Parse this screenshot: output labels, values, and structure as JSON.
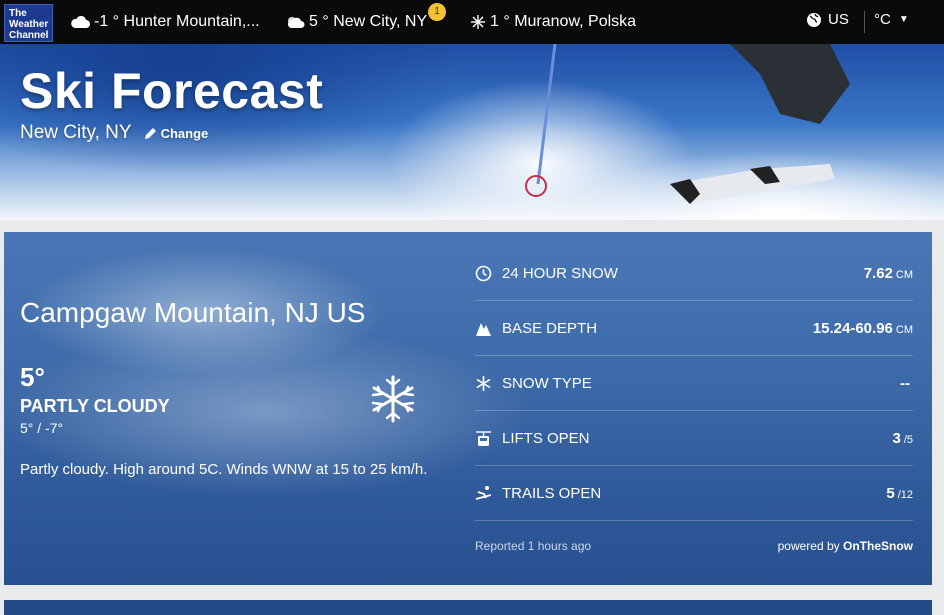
{
  "logo": {
    "line1": "The",
    "line2": "Weather",
    "line3": "Channel"
  },
  "nav": {
    "locations": [
      {
        "temp": "-1 °",
        "name": "Hunter Mountain,...",
        "icon": "cloud-icon"
      },
      {
        "temp": "5 °",
        "name": "New City, NY",
        "icon": "partly-cloudy-icon"
      },
      {
        "temp": "1 °",
        "name": "Muranow, Polska",
        "icon": "snow-icon"
      }
    ],
    "badge_count": "1",
    "region": "US",
    "temp_unit": "°C"
  },
  "hero": {
    "title": "Ski Forecast",
    "city": "New City, NY",
    "change_label": "Change"
  },
  "resort": {
    "name": "Campgaw Mountain, NJ US",
    "current_temp": "5°",
    "condition": "PARTLY CLOUDY",
    "hi_lo": "5° / -7°",
    "description": "Partly cloudy. High around 5C. Winds WNW at 15 to 25 km/h.",
    "icon": "snowflake-icon"
  },
  "stats": [
    {
      "label": "24 HOUR SNOW",
      "value": "7.62",
      "unit": "CM",
      "icon": "clock-icon"
    },
    {
      "label": "BASE DEPTH",
      "value": "15.24-60.96",
      "unit": "CM",
      "icon": "mountain-icon"
    },
    {
      "label": "SNOW TYPE",
      "value": "--",
      "unit": "",
      "icon": "snowflake-icon"
    },
    {
      "label": "LIFTS OPEN",
      "value": "3",
      "unit": "/5",
      "icon": "gondola-icon"
    },
    {
      "label": "TRAILS OPEN",
      "value": "5",
      "unit": "/12",
      "icon": "skier-icon"
    }
  ],
  "footer": {
    "reported": "Reported 1 hours ago",
    "powered_prefix": "powered by",
    "powered_brand": "OnTheSnow"
  },
  "colors": {
    "nav_bg": "#0a0a0a",
    "logo_bg": "#1e3a8f",
    "badge": "#f2c230",
    "card": "#3d6aa8"
  }
}
